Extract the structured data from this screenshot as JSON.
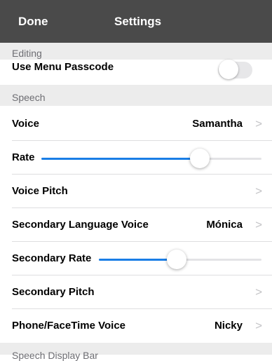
{
  "navbar": {
    "done_label": "Done",
    "title": "Settings"
  },
  "sections": {
    "editing": "Editing",
    "speech": "Speech",
    "speech_display_bar": "Speech Display Bar"
  },
  "editing": {
    "use_menu_passcode": {
      "label": "Use Menu Passcode",
      "on": false
    }
  },
  "speech": {
    "voice": {
      "label": "Voice",
      "value": "Samantha"
    },
    "rate": {
      "label": "Rate",
      "level": 0.72
    },
    "voice_pitch": {
      "label": "Voice Pitch"
    },
    "secondary_language_voice": {
      "label": "Secondary Language Voice",
      "value": "Mónica"
    },
    "secondary_rate": {
      "label": "Secondary Rate",
      "level": 0.48
    },
    "secondary_pitch": {
      "label": "Secondary Pitch"
    },
    "phone_facetime_voice": {
      "label": "Phone/FaceTime Voice",
      "value": "Nicky"
    }
  },
  "chevron_glyph": ">",
  "colors": {
    "navbar": "#4a4a4a",
    "accent": "#1a7ee6",
    "section_bg": "#ececec"
  }
}
